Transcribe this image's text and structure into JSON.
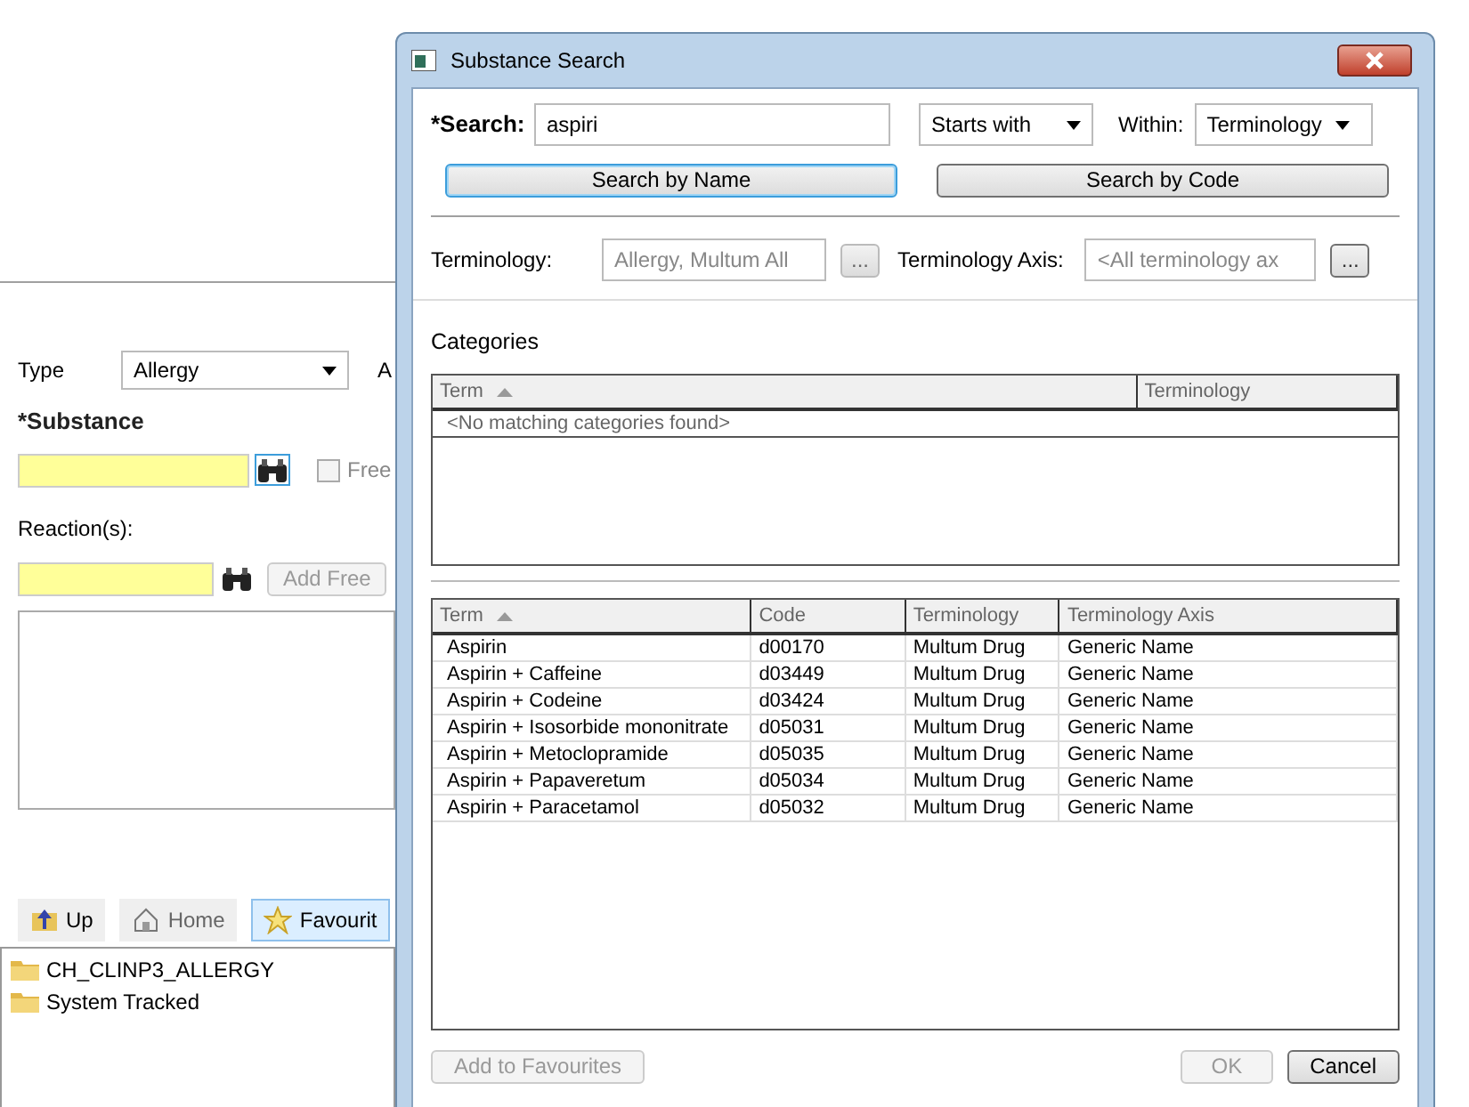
{
  "background": {
    "type_label": "Type",
    "type_value": "Allergy",
    "cut_label": "A",
    "substance_label": "*Substance",
    "free_text": {
      "label": "Free",
      "checked": false
    },
    "reactions_label": "Reaction(s):",
    "add_free": {
      "label": "Add Free",
      "disabled": true
    },
    "nav": [
      {
        "label": "Up",
        "kind": "up",
        "disabled": false,
        "selected": false
      },
      {
        "label": "Home",
        "kind": "home",
        "disabled": true,
        "selected": false
      },
      {
        "label": "Favourit",
        "kind": "star",
        "disabled": false,
        "selected": true
      }
    ],
    "folders": [
      "CH_CLINP3_ALLERGY",
      "System Tracked"
    ]
  },
  "dialog": {
    "title": "Substance Search",
    "search_label": "*Search:",
    "search_value": "aspiri",
    "match_mode": "Starts with",
    "within_label": "Within:",
    "within_value": "Terminology",
    "buttons": [
      {
        "label": "Search by Name",
        "focused": true
      },
      {
        "label": "Search by Code",
        "focused": false
      }
    ],
    "terminology_label": "Terminology:",
    "terminology_value": "Allergy, Multum All",
    "terminology_browse": "...",
    "axis_label": "Terminology Axis:",
    "axis_value": "<All terminology ax",
    "axis_browse": "...",
    "categories_title": "Categories",
    "categories": {
      "columns": [
        {
          "label": "Term",
          "sorted": true
        },
        {
          "label": "Terminology",
          "sorted": false
        }
      ],
      "empty": "<No matching categories found>"
    },
    "results": {
      "columns": [
        {
          "label": "Term",
          "sorted": true
        },
        {
          "label": "Code",
          "sorted": false
        },
        {
          "label": "Terminology",
          "sorted": false
        },
        {
          "label": "Terminology Axis",
          "sorted": false
        }
      ],
      "rows": [
        [
          "Aspirin",
          "d00170",
          "Multum Drug",
          "Generic Name"
        ],
        [
          "Aspirin + Caffeine",
          "d03449",
          "Multum Drug",
          "Generic Name"
        ],
        [
          "Aspirin + Codeine",
          "d03424",
          "Multum Drug",
          "Generic Name"
        ],
        [
          "Aspirin + Isosorbide mononitrate",
          "d05031",
          "Multum Drug",
          "Generic Name"
        ],
        [
          "Aspirin + Metoclopramide",
          "d05035",
          "Multum Drug",
          "Generic Name"
        ],
        [
          "Aspirin + Papaveretum",
          "d05034",
          "Multum Drug",
          "Generic Name"
        ],
        [
          "Aspirin + Paracetamol",
          "d05032",
          "Multum Drug",
          "Generic Name"
        ]
      ]
    },
    "footer": [
      {
        "label": "Add to Favourites",
        "disabled": true
      },
      {
        "label": "OK",
        "disabled": true
      },
      {
        "label": "Cancel",
        "disabled": false
      }
    ]
  }
}
